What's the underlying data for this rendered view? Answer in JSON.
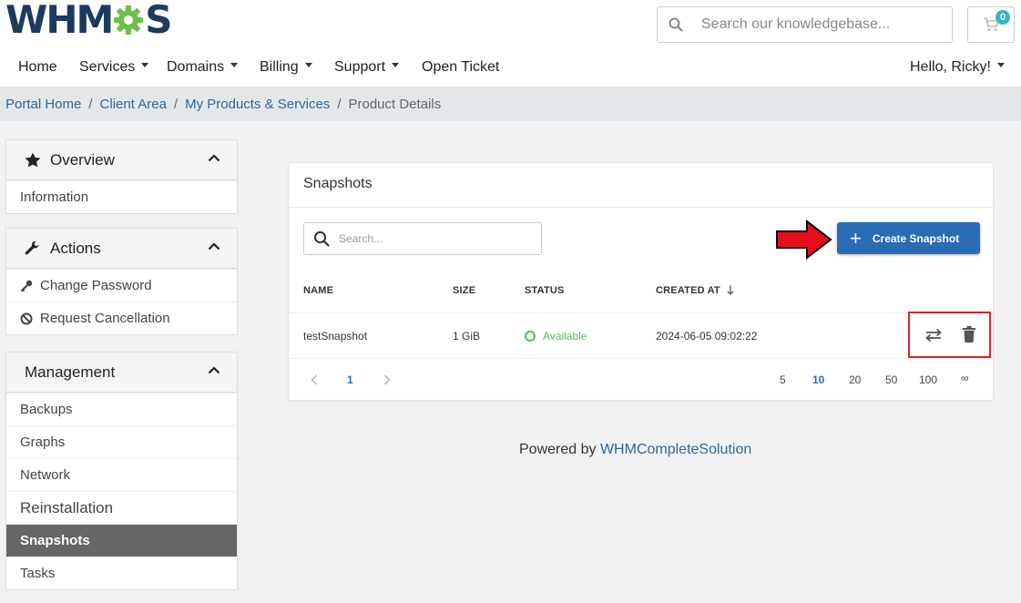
{
  "brand": {
    "logo_left": "WHM",
    "logo_right": "S"
  },
  "header": {
    "search_placeholder": "Search our knowledgebase...",
    "cart_count": "0"
  },
  "nav": {
    "home": "Home",
    "services": "Services",
    "domains": "Domains",
    "billing": "Billing",
    "support": "Support",
    "open_ticket": "Open Ticket",
    "user": "Hello, Ricky!"
  },
  "breadcrumb": {
    "items": [
      "Portal Home",
      "Client Area",
      "My Products & Services"
    ],
    "current": "Product Details"
  },
  "sidebar": {
    "overview": {
      "title": "Overview",
      "items": [
        "Information"
      ]
    },
    "actions": {
      "title": "Actions",
      "items": [
        "Change Password",
        "Request Cancellation"
      ]
    },
    "management": {
      "title": "Management",
      "items": [
        "Backups",
        "Graphs",
        "Network",
        "Reinstallation",
        "Snapshots",
        "Tasks"
      ],
      "active": "Snapshots"
    }
  },
  "snapshots": {
    "title": "Snapshots",
    "search_placeholder": "Search...",
    "create_label": "Create Snapshot",
    "columns": [
      "NAME",
      "SIZE",
      "STATUS",
      "CREATED AT"
    ],
    "rows": [
      {
        "name": "testSnapshot",
        "size": "1 GiB",
        "status": "Available",
        "created_at": "2024-06-05 09:02:22"
      }
    ],
    "pagination": {
      "current_page": "1",
      "page_sizes": [
        "5",
        "10",
        "20",
        "50",
        "100",
        "∞"
      ],
      "selected_size": "10"
    }
  },
  "footer": {
    "prefix": "Powered by",
    "link": "WHMCompleteSolution"
  },
  "colors": {
    "primary": "#2a6bb5",
    "link": "#336699",
    "success": "#5cb85c",
    "highlight": "#d9232d",
    "logo": "#1b3a5e",
    "gear": "#6cc04a"
  }
}
